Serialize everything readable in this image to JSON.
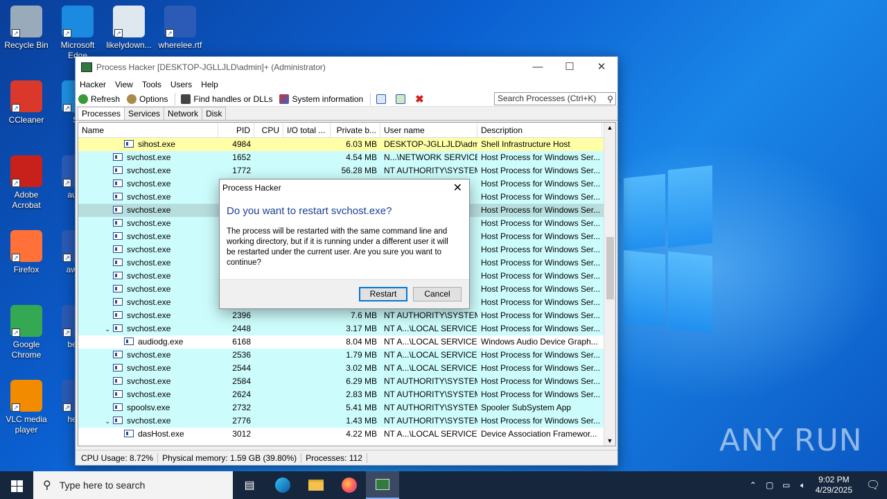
{
  "desktop": {
    "icons": [
      {
        "label": "Recycle Bin",
        "color": "#9ab"
      },
      {
        "label": "Microsoft Edge",
        "color": "#1a8be0"
      },
      {
        "label": "likelydown...",
        "color": "#dfe7ef"
      },
      {
        "label": "wherelee.rtf",
        "color": "#2b5bb7"
      },
      {
        "label": "CCleaner",
        "color": "#d9382a"
      },
      {
        "label": "Sk",
        "color": "#1f8fe0"
      },
      {
        "label": "Adobe Acrobat",
        "color": "#c8201b"
      },
      {
        "label": "audio",
        "color": "#2b5bb7"
      },
      {
        "label": "Firefox",
        "color": "#ff7139"
      },
      {
        "label": "award",
        "color": "#2b5bb7"
      },
      {
        "label": "Google Chrome",
        "color": "#34a853"
      },
      {
        "label": "bestp",
        "color": "#2b5bb7"
      },
      {
        "label": "VLC media player",
        "color": "#f28b00"
      },
      {
        "label": "heldb",
        "color": "#2b5bb7"
      }
    ]
  },
  "window": {
    "title": "Process Hacker [DESKTOP-JGLLJLD\\admin]+ (Administrator)",
    "menu": [
      "Hacker",
      "View",
      "Tools",
      "Users",
      "Help"
    ],
    "toolbar": {
      "refresh": "Refresh",
      "options": "Options",
      "find": "Find handles or DLLs",
      "sysinfo": "System information"
    },
    "search_placeholder": "Search Processes (Ctrl+K)",
    "tabs": [
      "Processes",
      "Services",
      "Network",
      "Disk"
    ],
    "columns": [
      "Name",
      "PID",
      "CPU",
      "I/O total ...",
      "Private b...",
      "User name",
      "Description"
    ],
    "rows": [
      {
        "name": "sihost.exe",
        "pid": "4984",
        "priv": "6.03 MB",
        "user": "DESKTOP-JGLLJLD\\admi",
        "desc": "Shell Infrastructure Host",
        "bg": "#ffffa8",
        "indent": 2
      },
      {
        "name": "svchost.exe",
        "pid": "1652",
        "priv": "4.54 MB",
        "user": "N...\\NETWORK SERVICE",
        "desc": "Host Process for Windows Ser...",
        "bg": "#cdfcfc",
        "indent": 1
      },
      {
        "name": "svchost.exe",
        "pid": "1772",
        "priv": "56.28 MB",
        "user": "NT AUTHORITY\\SYSTEM",
        "desc": "Host Process for Windows Ser...",
        "bg": "#cdfcfc",
        "indent": 1
      },
      {
        "name": "svchost.exe",
        "pid": "",
        "priv": "",
        "user": "",
        "desc": "Host Process for Windows Ser...",
        "bg": "#cdfcfc",
        "indent": 1
      },
      {
        "name": "svchost.exe",
        "pid": "",
        "priv": "",
        "user": "",
        "desc": "Host Process for Windows Ser...",
        "bg": "#cdfcfc",
        "indent": 1
      },
      {
        "name": "svchost.exe",
        "pid": "",
        "priv": "",
        "user": "",
        "desc": "Host Process for Windows Ser...",
        "bg": "#b7dddd",
        "indent": 1
      },
      {
        "name": "svchost.exe",
        "pid": "",
        "priv": "",
        "user": "M",
        "desc": "Host Process for Windows Ser...",
        "bg": "#cdfcfc",
        "indent": 1
      },
      {
        "name": "svchost.exe",
        "pid": "",
        "priv": "",
        "user": "M",
        "desc": "Host Process for Windows Ser...",
        "bg": "#cdfcfc",
        "indent": 1
      },
      {
        "name": "svchost.exe",
        "pid": "",
        "priv": "",
        "user": "",
        "desc": "Host Process for Windows Ser...",
        "bg": "#cdfcfc",
        "indent": 1
      },
      {
        "name": "svchost.exe",
        "pid": "",
        "priv": "",
        "user": "",
        "desc": "Host Process for Windows Ser...",
        "bg": "#cdfcfc",
        "indent": 1
      },
      {
        "name": "svchost.exe",
        "pid": "",
        "priv": "",
        "user": "",
        "desc": "Host Process for Windows Ser...",
        "bg": "#cdfcfc",
        "indent": 1
      },
      {
        "name": "svchost.exe",
        "pid": "",
        "priv": "",
        "user": "",
        "desc": "Host Process for Windows Ser...",
        "bg": "#cdfcfc",
        "indent": 1
      },
      {
        "name": "svchost.exe",
        "pid": "",
        "priv": "",
        "user": "",
        "desc": "Host Process for Windows Ser...",
        "bg": "#cdfcfc",
        "indent": 1
      },
      {
        "name": "svchost.exe",
        "pid": "2396",
        "priv": "7.6 MB",
        "user": "NT AUTHORITY\\SYSTEM",
        "desc": "Host Process for Windows Ser...",
        "bg": "#cdfcfc",
        "indent": 1
      },
      {
        "name": "svchost.exe",
        "pid": "2448",
        "priv": "3.17 MB",
        "user": "NT A...\\LOCAL SERVICE",
        "desc": "Host Process for Windows Ser...",
        "bg": "#cdfcfc",
        "indent": 1,
        "expanded": true
      },
      {
        "name": "audiodg.exe",
        "pid": "6168",
        "priv": "8.04 MB",
        "user": "NT A...\\LOCAL SERVICE",
        "desc": "Windows Audio Device Graph...",
        "bg": "#ffffff",
        "indent": 2
      },
      {
        "name": "svchost.exe",
        "pid": "2536",
        "priv": "1.79 MB",
        "user": "NT A...\\LOCAL SERVICE",
        "desc": "Host Process for Windows Ser...",
        "bg": "#cdfcfc",
        "indent": 1
      },
      {
        "name": "svchost.exe",
        "pid": "2544",
        "priv": "3.02 MB",
        "user": "NT A...\\LOCAL SERVICE",
        "desc": "Host Process for Windows Ser...",
        "bg": "#cdfcfc",
        "indent": 1
      },
      {
        "name": "svchost.exe",
        "pid": "2584",
        "priv": "6.29 MB",
        "user": "NT AUTHORITY\\SYSTEM",
        "desc": "Host Process for Windows Ser...",
        "bg": "#cdfcfc",
        "indent": 1
      },
      {
        "name": "svchost.exe",
        "pid": "2624",
        "priv": "2.83 MB",
        "user": "NT AUTHORITY\\SYSTEM",
        "desc": "Host Process for Windows Ser...",
        "bg": "#cdfcfc",
        "indent": 1
      },
      {
        "name": "spoolsv.exe",
        "pid": "2732",
        "priv": "5.41 MB",
        "user": "NT AUTHORITY\\SYSTEM",
        "desc": "Spooler SubSystem App",
        "bg": "#cdfcfc",
        "indent": 1
      },
      {
        "name": "svchost.exe",
        "pid": "2776",
        "priv": "1.43 MB",
        "user": "NT AUTHORITY\\SYSTEM",
        "desc": "Host Process for Windows Ser...",
        "bg": "#cdfcfc",
        "indent": 1,
        "expanded": true
      },
      {
        "name": "dasHost.exe",
        "pid": "3012",
        "priv": "4.22 MB",
        "user": "NT A...\\LOCAL SERVICE",
        "desc": "Device Association Framewor...",
        "bg": "#ffffff",
        "indent": 2
      }
    ],
    "status": {
      "cpu": "CPU Usage: 8.72%",
      "mem": "Physical memory: 1.59 GB (39.80%)",
      "procs": "Processes: 112"
    }
  },
  "dialog": {
    "title": "Process Hacker",
    "heading": "Do you want to restart svchost.exe?",
    "body": "The process will be restarted with the same command line and working directory, but if it is running under a different user it will be restarted under the current user. Are you sure you want to continue?",
    "ok": "Restart",
    "cancel": "Cancel"
  },
  "taskbar": {
    "search_placeholder": "Type here to search",
    "time": "9:02 PM",
    "date": "4/29/2025"
  },
  "watermark": "ANY RUN"
}
